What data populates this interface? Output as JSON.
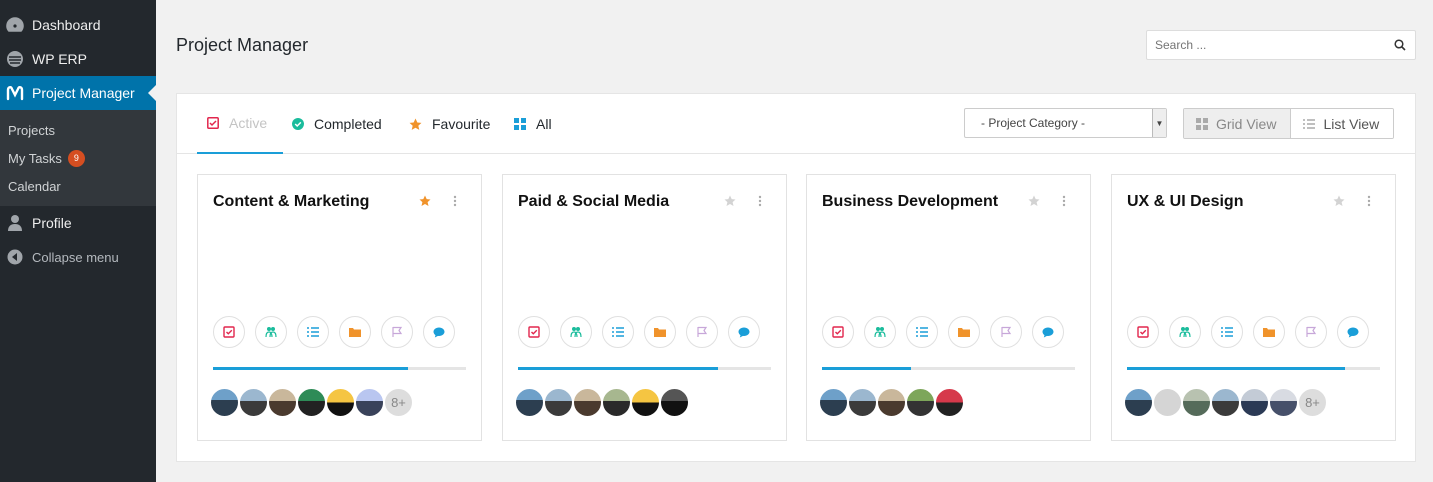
{
  "sidebar": {
    "items": [
      {
        "label": "Dashboard",
        "icon": "dashboard-icon"
      },
      {
        "label": "WP ERP",
        "icon": "erp-icon"
      },
      {
        "label": "Project Manager",
        "icon": "project-manager-icon"
      }
    ],
    "submenu": [
      {
        "label": "Projects"
      },
      {
        "label": "My Tasks",
        "badge": "9"
      },
      {
        "label": "Calendar"
      }
    ],
    "profile_label": "Profile",
    "collapse_label": "Collapse menu"
  },
  "header": {
    "title": "Project Manager",
    "search_placeholder": "Search ..."
  },
  "tabs": [
    {
      "label": "Active",
      "icon": "active-checkbox-icon",
      "color": "#e2264d"
    },
    {
      "label": "Completed",
      "icon": "completed-check-icon",
      "color": "#1abc9c"
    },
    {
      "label": "Favourite",
      "icon": "star-icon",
      "color": "#f0932b"
    },
    {
      "label": "All",
      "icon": "grid-icon",
      "color": "#1a9ed8"
    }
  ],
  "filters": {
    "category_selected": "- Project Category -",
    "grid_view_label": "Grid View",
    "list_view_label": "List View"
  },
  "colors": {
    "accent": "#1a9ed8",
    "sidebar_bg": "#23282d",
    "active_menu": "#0073aa",
    "favourite_star": "#f0932b"
  },
  "projects": [
    {
      "title": "Content & Marketing",
      "favourite": true,
      "progress": 0.77,
      "more_members": "8+"
    },
    {
      "title": "Paid & Social Media",
      "favourite": false,
      "progress": 0.79,
      "more_members": ""
    },
    {
      "title": "Business Development",
      "favourite": false,
      "progress": 0.35,
      "more_members": ""
    },
    {
      "title": "UX & UI Design",
      "favourite": false,
      "progress": 0.86,
      "more_members": "8+"
    }
  ]
}
